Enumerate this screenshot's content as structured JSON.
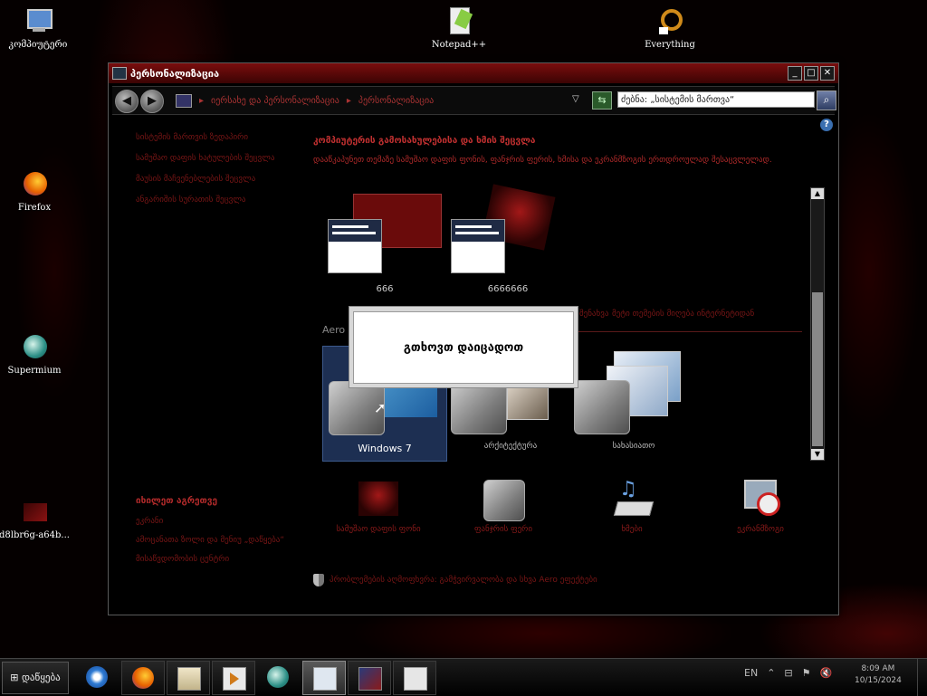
{
  "desktop": {
    "icons": [
      {
        "label": "კომპიუტერი"
      },
      {
        "label": "Notepad++"
      },
      {
        "label": "Everything"
      },
      {
        "label": "Firefox"
      },
      {
        "label": "Supermium"
      },
      {
        "label": "d8lbr6g-a64b..."
      }
    ]
  },
  "window": {
    "title": "პერსონალიზაცია",
    "breadcrumb": [
      "იერსახე და პერსონალიზაცია",
      "პერსონალიზაცია"
    ],
    "search_placeholder": "ძებნა: „სისტემის მართვა“",
    "left_nav": [
      "სისტემის მართვის ზედაპირი",
      "სამუშაო დაფის ხატულების შეცვლა",
      "მაუსის მაჩვენებლების შეცვლა",
      "ანგარიშის სურათის შეცვლა"
    ],
    "heading": "კომპიუტერის გამოსახულებისა და ხმის შეცვლა",
    "description": "დააწკაპუნეთ თემაზე სამუშაო დაფის ფონის, ფანჯრის ფერის, ხმისა და ეკრანმზოგის ერთდროულად შესაცვლელად.",
    "my_themes": [
      {
        "name": "666"
      },
      {
        "name": "6666666"
      }
    ],
    "online_links": [
      "შენახვა",
      "მეტი თემების მიღება ინტერნეტიდან"
    ],
    "aero_label": "Aero",
    "aero_themes": [
      {
        "name": "Windows 7"
      },
      {
        "name": "არქიტექტურა"
      },
      {
        "name": "სახასიათო"
      }
    ],
    "modal_text": "გთხოვთ დაიცადოთ",
    "see_also_title": "იხილეთ აგრეთვე",
    "see_also": [
      "ეკრანი",
      "ამოცანათა ზოლი და მენიუ „დაწყება“",
      "მისაწვდომობის ცენტრი"
    ],
    "bottom": [
      {
        "label": "სამუშაო დაფის ფონი"
      },
      {
        "label": "ფანჯრის ფერი"
      },
      {
        "label": "ხმები"
      },
      {
        "label": "ეკრანმზოგი"
      }
    ],
    "shield_note": "პრობლემების აღმოფხვრა: გამჭვირვალობა და სხვა Aero ეფექტები"
  },
  "taskbar": {
    "start_label": "დაწყება",
    "lang": "EN",
    "time": "8:09 AM",
    "date": "10/15/2024"
  },
  "colors": {
    "accent": "#7a0d0d",
    "link": "#7a1616",
    "heading": "#c03030"
  }
}
